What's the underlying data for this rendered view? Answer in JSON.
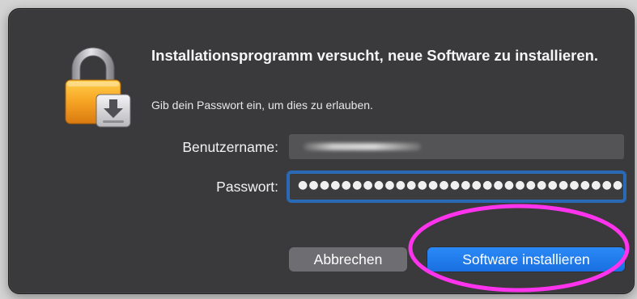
{
  "dialog": {
    "title": "Installationsprogramm versucht, neue Software zu installieren.",
    "message": "Gib dein Passwort ein, um dies zu erlauben.",
    "username_label": "Benutzername:",
    "username_value": "",
    "password_label": "Passwort:",
    "password_mask": "●●●●●●●●●●●●●●●●●●●●●●●●●●●●●●",
    "cancel_label": "Abbrechen",
    "install_label": "Software installieren"
  },
  "icons": {
    "app_icon": "lock-with-installer-icon"
  },
  "colors": {
    "dialog_background": "#3a3a3c",
    "primary_button": "#2b8af7",
    "secondary_button": "#6e6e72",
    "focus_ring": "#2478dc",
    "annotation_ellipse": "#ff33ee"
  }
}
